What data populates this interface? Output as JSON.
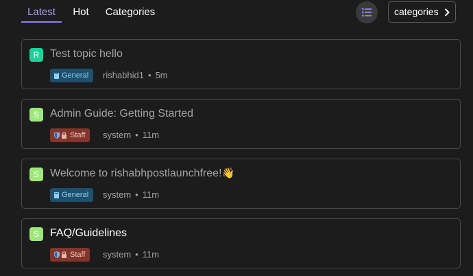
{
  "tabs": [
    {
      "label": "Latest",
      "active": true
    },
    {
      "label": "Hot",
      "active": false
    },
    {
      "label": "Categories",
      "active": false
    }
  ],
  "toolbar": {
    "list_icon": "list-icon",
    "categories_button": "categories",
    "chevron_icon": "chevron-right-icon"
  },
  "topics": [
    {
      "avatar_letter": "R",
      "avatar_color": "#1ad39a",
      "title": "Test topic hello",
      "category": "General",
      "category_icon": "category-book-icon",
      "author": "rishabhid1",
      "separator": "•",
      "time": "5m"
    },
    {
      "avatar_letter": "S",
      "avatar_color": "#9ee879",
      "title": "Admin Guide: Getting Started",
      "category": "Staff",
      "category_icon": "shield-lock-icon",
      "author": "system",
      "separator": "•",
      "time": "11m"
    },
    {
      "avatar_letter": "S",
      "avatar_color": "#9ee879",
      "title": "Welcome to rishabhpostlaunchfree!",
      "emoji": "👋",
      "category": "General",
      "category_icon": "category-book-icon",
      "author": "system",
      "separator": "•",
      "time": "11m"
    },
    {
      "avatar_letter": "S",
      "avatar_color": "#9ee879",
      "title": "FAQ/Guidelines",
      "category": "Staff",
      "category_icon": "shield-lock-icon",
      "author": "system",
      "separator": "•",
      "time": "11m"
    }
  ],
  "colors": {
    "background": "#1d1c1c",
    "accent": "#a8a0f0",
    "general_badge": "#1e4f6d",
    "staff_badge": "#82352a"
  }
}
